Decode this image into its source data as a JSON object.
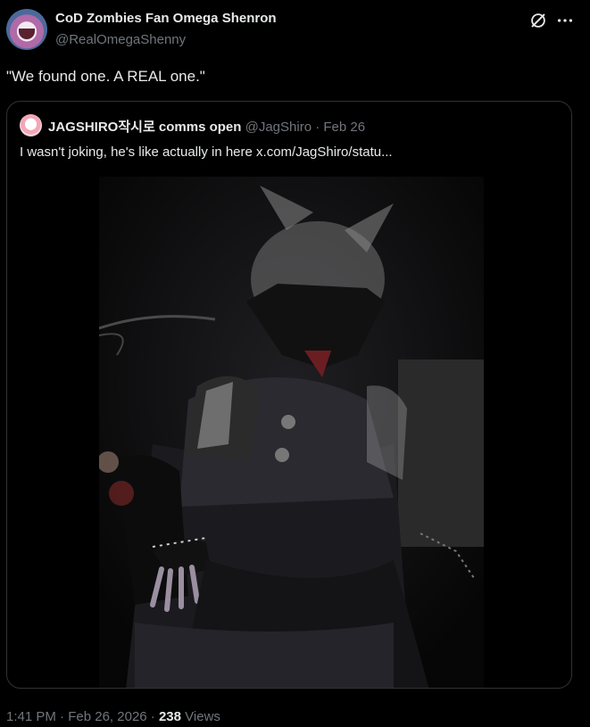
{
  "author": {
    "display_name": "CoD Zombies Fan Omega Shenron",
    "handle": "@RealOmegaShenny"
  },
  "icons": {
    "avatar": "avatar-image",
    "grok": "grok-icon",
    "more": "more-options-icon"
  },
  "tweet": {
    "text": "\"We found one. A REAL one.\""
  },
  "quote": {
    "display_name": "JAGSHIRO작시로 comms open",
    "handle": "@JagShiro",
    "separator": "·",
    "date": "Feb 26",
    "text": "I wasn't joking, he's like actually in here  x.com/JagShiro/statu...",
    "media": "dark photo of a person in a furry costume with horns, gloves and dark coat, sitting in a dim room"
  },
  "footer": {
    "time": "1:41 PM",
    "separator": "·",
    "date": "Feb 26, 2026",
    "separator2": "·",
    "views_count": "238",
    "views_label": "Views"
  }
}
